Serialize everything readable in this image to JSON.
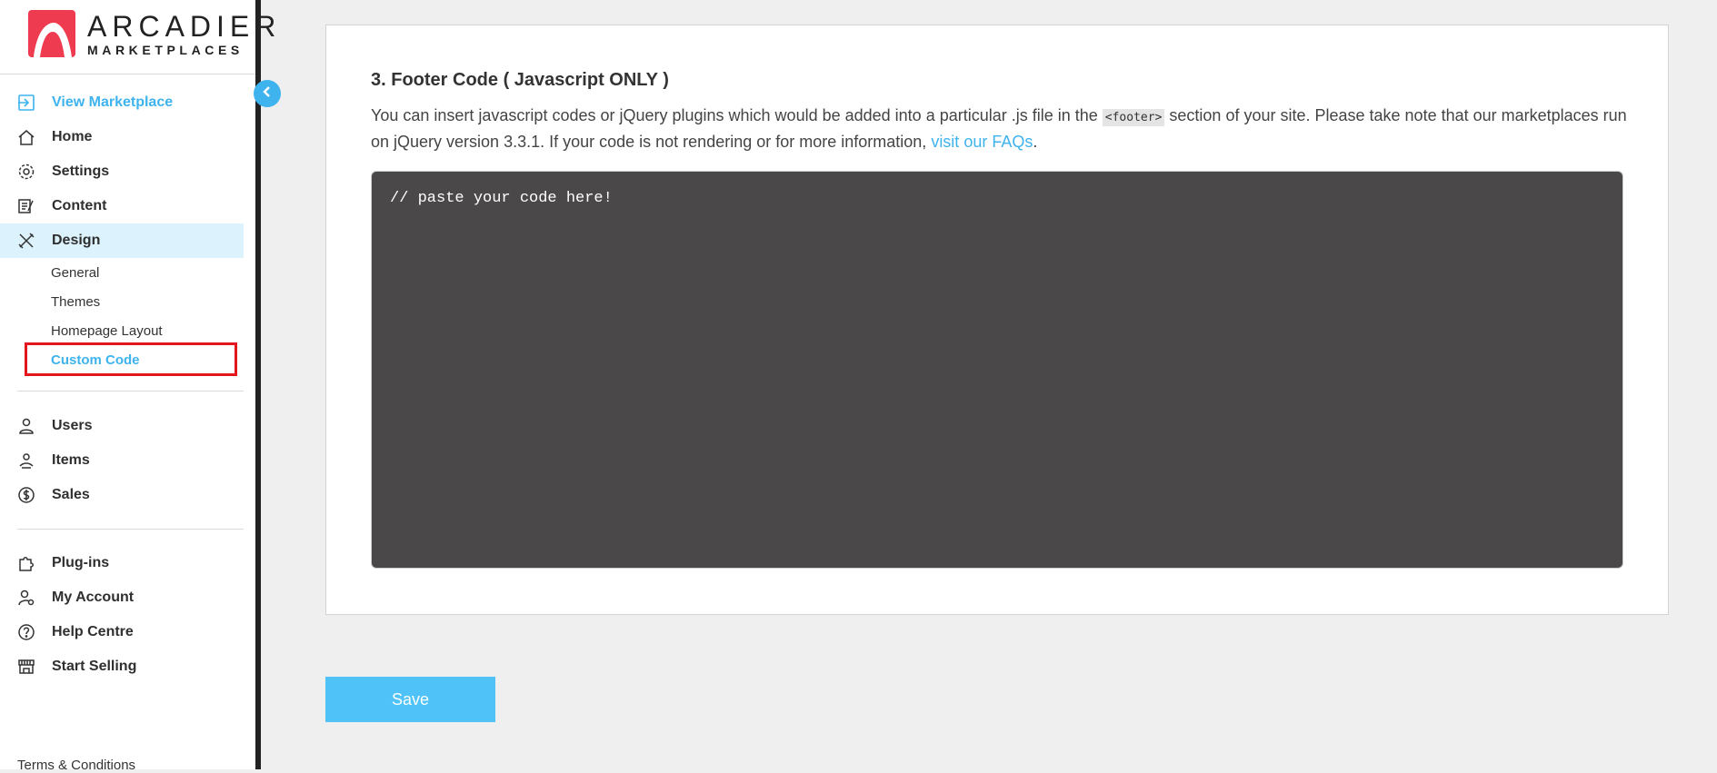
{
  "brand": {
    "title": "ARCADIER",
    "subtitle": "MARKETPLACES"
  },
  "sidebar": {
    "primary": [
      {
        "label": "View Marketplace",
        "icon": "enter-icon"
      },
      {
        "label": "Home",
        "icon": "home-icon"
      },
      {
        "label": "Settings",
        "icon": "gear-icon"
      },
      {
        "label": "Content",
        "icon": "content-icon"
      },
      {
        "label": "Design",
        "icon": "design-tools-icon"
      }
    ],
    "design_sub": [
      {
        "label": "General"
      },
      {
        "label": "Themes"
      },
      {
        "label": "Homepage Layout"
      },
      {
        "label": "Custom Code"
      }
    ],
    "secondary": [
      {
        "label": "Users",
        "icon": "user-icon"
      },
      {
        "label": "Items",
        "icon": "items-icon"
      },
      {
        "label": "Sales",
        "icon": "dollar-icon"
      }
    ],
    "tertiary": [
      {
        "label": "Plug-ins",
        "icon": "puzzle-icon"
      },
      {
        "label": "My Account",
        "icon": "account-gear-icon"
      },
      {
        "label": "Help Centre",
        "icon": "question-icon"
      },
      {
        "label": "Start Selling",
        "icon": "storefront-icon"
      }
    ],
    "terms": "Terms & Conditions"
  },
  "main": {
    "title": "3. Footer Code ( Javascript ONLY )",
    "desc_part1": "You can insert javascript codes or jQuery plugins which would be added into a particular .js file in the ",
    "desc_code": "<footer>",
    "desc_part2": " section of your site. Please take note that our marketplaces run on jQuery version 3.3.1. If your code is not rendering or for more information, ",
    "desc_link": "visit our FAQs",
    "desc_end": ".",
    "code_value": "// paste your code here!",
    "save_label": "Save"
  },
  "colors": {
    "accent": "#3eb3ed",
    "brand": "#ef3b4f",
    "editor_bg": "#4a4849",
    "highlight": "#e3161e"
  }
}
